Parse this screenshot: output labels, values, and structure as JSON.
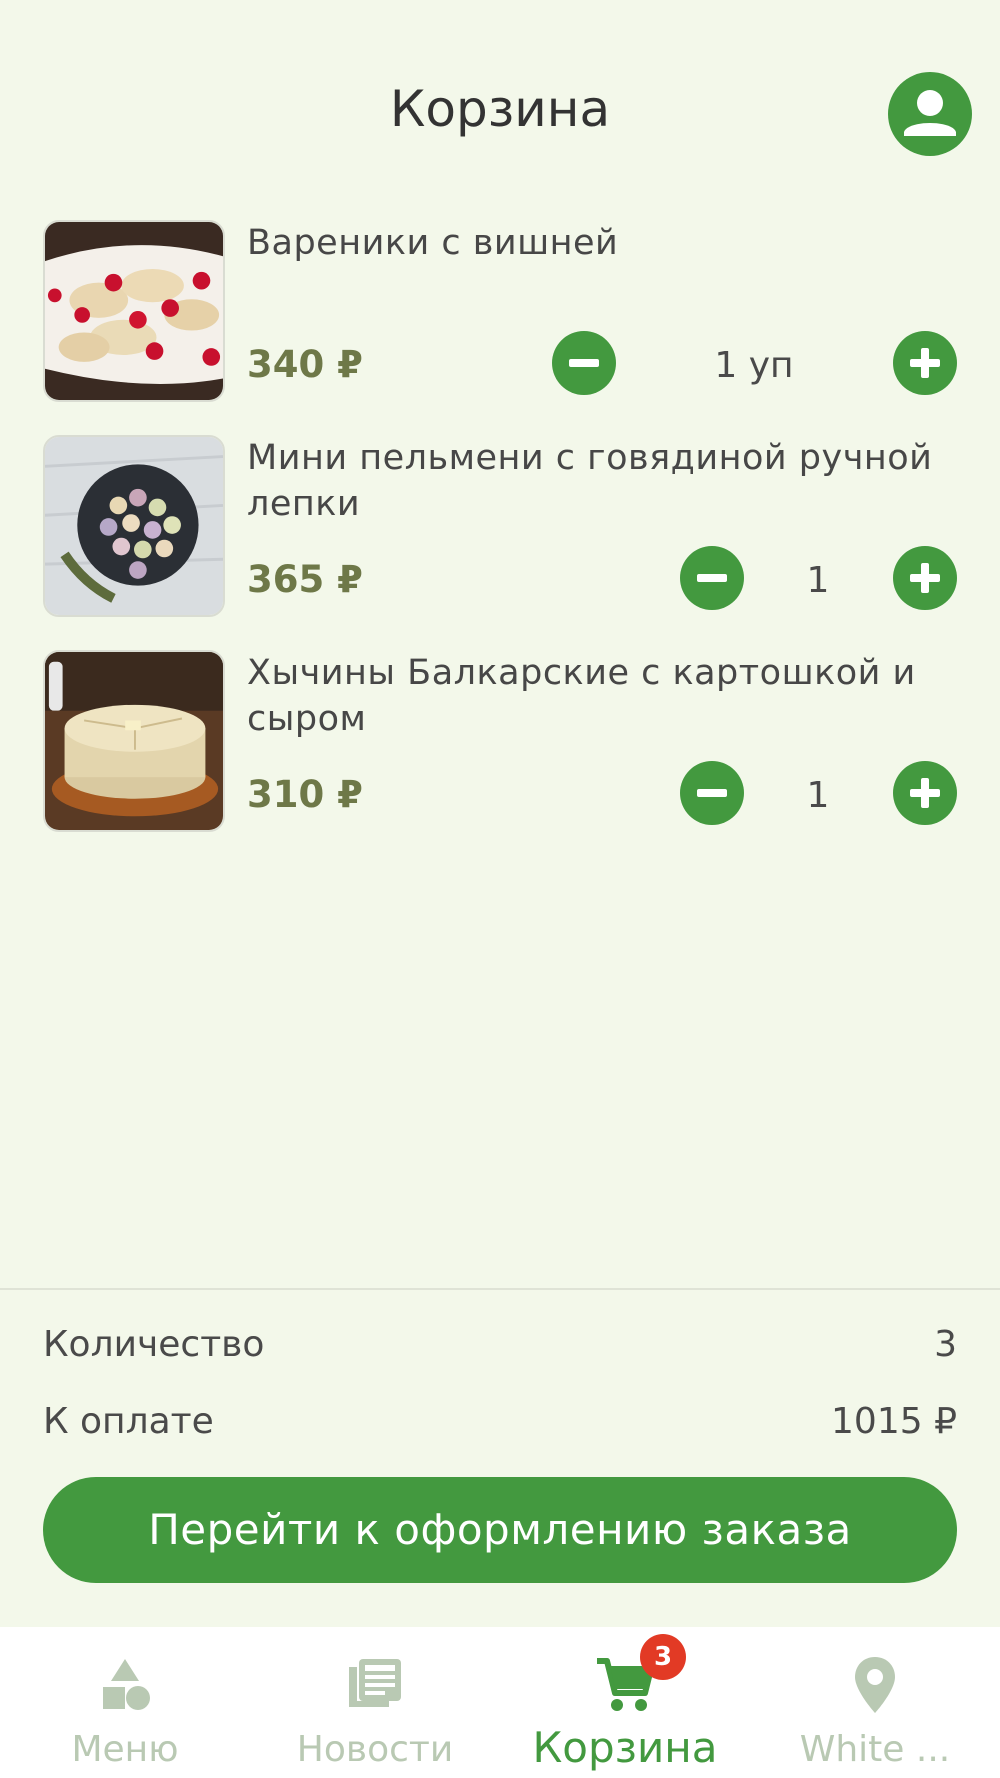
{
  "header": {
    "title": "Корзина",
    "profile_icon": "account-circle-icon"
  },
  "cart": {
    "items": [
      {
        "name": "Вареники с вишней",
        "price": "340 ₽",
        "quantity": "1 уп"
      },
      {
        "name": "Мини пельмени с говядиной ручной лепки",
        "price": "365 ₽",
        "quantity": "1"
      },
      {
        "name": "Хычины Балкарские с картошкой и сыром",
        "price": "310 ₽",
        "quantity": "1"
      }
    ]
  },
  "summary": {
    "count_label": "Количество",
    "count_value": "3",
    "total_label": "К оплате",
    "total_value": "1015 ₽"
  },
  "checkout_label": "Перейти к оформлению заказа",
  "tabbar": {
    "tabs": [
      {
        "label": "Меню",
        "icon": "shapes-icon"
      },
      {
        "label": "Новости",
        "icon": "newspaper-icon"
      },
      {
        "label": "Корзина",
        "icon": "cart-icon"
      },
      {
        "label": "White ...",
        "icon": "location-pin-icon"
      }
    ],
    "cart_badge": "3"
  },
  "colors": {
    "accent": "#43993f",
    "background": "#f3f8ea",
    "badge": "#e23a25",
    "price": "#6e7848",
    "inactive_tab": "#b9c9b3"
  }
}
